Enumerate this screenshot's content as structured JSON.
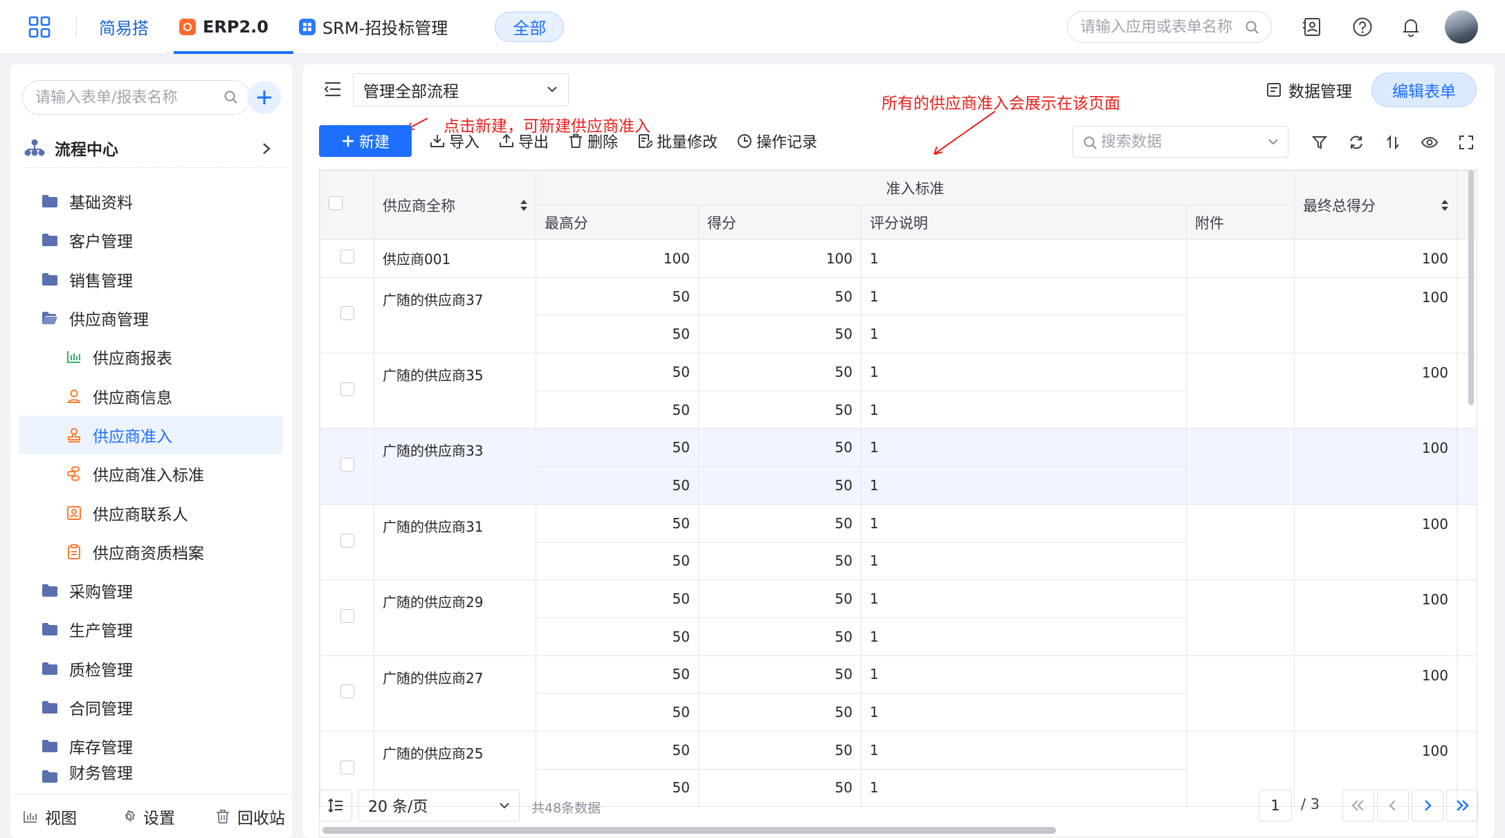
{
  "topbar": {
    "tabs": [
      {
        "label": "简易搭"
      },
      {
        "label": "ERP2.0"
      },
      {
        "label": "SRM-招投标管理"
      }
    ],
    "all_pill": "全部",
    "search_placeholder": "请输入应用或表单名称"
  },
  "sidebar": {
    "search_placeholder": "请输入表单/报表名称",
    "flow_center": "流程中心",
    "items": [
      {
        "label": "基础资料"
      },
      {
        "label": "客户管理"
      },
      {
        "label": "销售管理"
      },
      {
        "label": "供应商管理"
      },
      {
        "label": "供应商报表"
      },
      {
        "label": "供应商信息"
      },
      {
        "label": "供应商准入"
      },
      {
        "label": "供应商准入标准"
      },
      {
        "label": "供应商联系人"
      },
      {
        "label": "供应商资质档案"
      },
      {
        "label": "采购管理"
      },
      {
        "label": "生产管理"
      },
      {
        "label": "质检管理"
      },
      {
        "label": "合同管理"
      },
      {
        "label": "库存管理"
      },
      {
        "label": "财务管理"
      }
    ],
    "footer": {
      "view": "视图",
      "settings": "设置",
      "recycle": "回收站"
    }
  },
  "main": {
    "flow_select": "管理全部流程",
    "data_mgmt": "数据管理",
    "edit_form": "编辑表单",
    "annotations": {
      "top": "所有的供应商准入会展示在该页面",
      "new": "点击新建，可新建供应商准入"
    },
    "toolbar": {
      "new": "新建",
      "import": "导入",
      "export": "导出",
      "delete": "删除",
      "batch_edit": "批量修改",
      "op_log": "操作记录"
    },
    "data_search_placeholder": "搜索数据"
  },
  "table": {
    "headers": {
      "supplier": "供应商全称",
      "group": "准入标准",
      "max": "最高分",
      "score": "得分",
      "desc": "评分说明",
      "attach": "附件",
      "final": "最终总得分"
    },
    "records": [
      {
        "name": "供应商001",
        "final": "100",
        "subs": [
          {
            "max": "100",
            "score": "100",
            "desc": "1"
          }
        ]
      },
      {
        "name": "广随的供应商37",
        "final": "100",
        "subs": [
          {
            "max": "50",
            "score": "50",
            "desc": "1"
          },
          {
            "max": "50",
            "score": "50",
            "desc": "1"
          }
        ]
      },
      {
        "name": "广随的供应商35",
        "final": "100",
        "subs": [
          {
            "max": "50",
            "score": "50",
            "desc": "1"
          },
          {
            "max": "50",
            "score": "50",
            "desc": "1"
          }
        ]
      },
      {
        "name": "广随的供应商33",
        "final": "100",
        "highlight": true,
        "subs": [
          {
            "max": "50",
            "score": "50",
            "desc": "1"
          },
          {
            "max": "50",
            "score": "50",
            "desc": "1"
          }
        ]
      },
      {
        "name": "广随的供应商31",
        "final": "100",
        "subs": [
          {
            "max": "50",
            "score": "50",
            "desc": "1"
          },
          {
            "max": "50",
            "score": "50",
            "desc": "1"
          }
        ]
      },
      {
        "name": "广随的供应商29",
        "final": "100",
        "subs": [
          {
            "max": "50",
            "score": "50",
            "desc": "1"
          },
          {
            "max": "50",
            "score": "50",
            "desc": "1"
          }
        ]
      },
      {
        "name": "广随的供应商27",
        "final": "100",
        "subs": [
          {
            "max": "50",
            "score": "50",
            "desc": "1"
          },
          {
            "max": "50",
            "score": "50",
            "desc": "1"
          }
        ]
      },
      {
        "name": "广随的供应商25",
        "final": "100",
        "subs": [
          {
            "max": "50",
            "score": "50",
            "desc": "1"
          },
          {
            "max": "50",
            "score": "50",
            "desc": "1"
          }
        ]
      }
    ]
  },
  "pagination": {
    "page_size": "20 条/页",
    "total": "共48条数据",
    "current": "1",
    "pages": "/ 3"
  },
  "colors": {
    "primary": "#1e6fff",
    "annotation": "#e8201c",
    "folder": "#5a6fb0",
    "sub_icon": "#ff7a2f"
  }
}
